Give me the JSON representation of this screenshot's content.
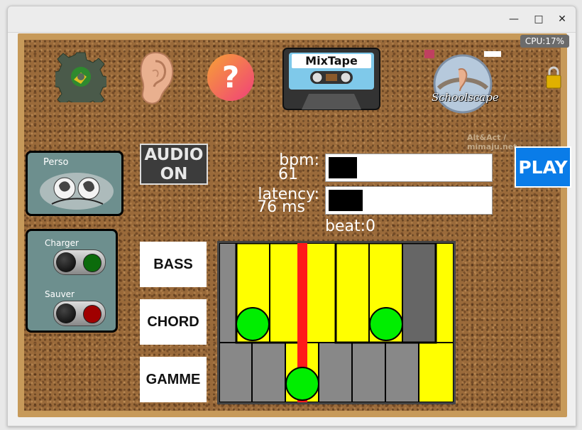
{
  "window": {
    "controls": {
      "minimize": "—",
      "maximize": "□",
      "close": "✕"
    }
  },
  "toolbar": {
    "cpu": "CPU:17%",
    "mixtape_label": "MixTape",
    "schoolscape_label": "Schoolscape",
    "credit": "Alt&Act / mimaju.net",
    "icons": [
      "gear-icon",
      "ear-icon",
      "help-icon",
      "mixtape-icon",
      "schoolscape-icon",
      "lock-icon"
    ]
  },
  "side": {
    "perso_label": "Perso",
    "charger_label": "Charger",
    "sauver_label": "Sauver",
    "charger_led_color": "#0b6b0b",
    "sauver_led_color": "#a00000"
  },
  "controls": {
    "audio_line1": "AUDIO",
    "audio_line2": "ON",
    "bpm_label": "bpm:",
    "bpm_value": "61",
    "latency_label": "latency:",
    "latency_value": "76 ms",
    "beat": "beat:0",
    "play": "PLAY"
  },
  "modes": [
    "BASS",
    "CHORD",
    "GAMME"
  ],
  "colors": {
    "active_key": "#ffff00",
    "note_dot": "#00ee00",
    "cursor": "#ff0000",
    "inactive_key": "#888888",
    "play": "#0a7ce8"
  }
}
